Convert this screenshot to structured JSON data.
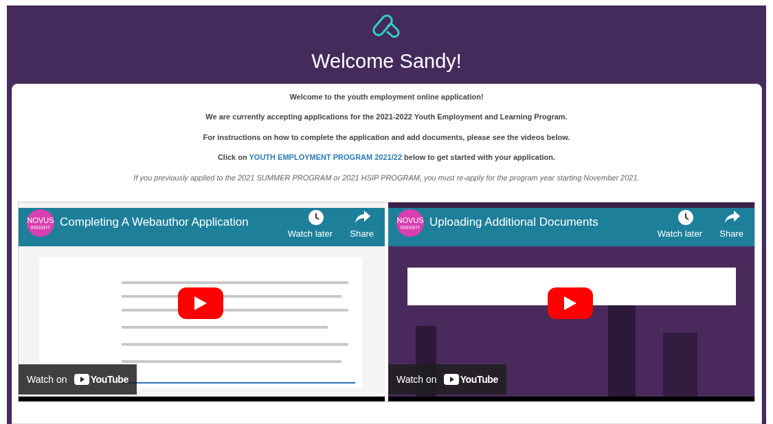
{
  "header": {
    "title": "Welcome Sandy!"
  },
  "intro": {
    "lines": [
      "Welcome to the youth employment online application!",
      "We are currently accepting applications for the 2021-2022 Youth Employment and Learning Program.",
      "For instructions on how to complete the application and add documents, please see the videos below."
    ],
    "cta": {
      "before": "Click on ",
      "link": "YOUTH EMPLOYMENT PROGRAM 2021/22",
      "after": " below to get started with your application."
    },
    "note": "If you previously applied to the 2021 SUMMER PROGRAM or 2021 HSIP PROGRAM, you must re-apply for the program year starting November 2021."
  },
  "videos": [
    {
      "channel": [
        "NOVUS",
        "INSIGHT"
      ],
      "title": "Completing A Webauthor Application",
      "watch_later": "Watch later",
      "share": "Share",
      "watch_on": "Watch on",
      "youtube": "YouTube"
    },
    {
      "channel": [
        "NOVUS",
        "INSIGHT"
      ],
      "title": "Uploading Additional Documents",
      "watch_later": "Watch later",
      "share": "Share",
      "watch_on": "Watch on",
      "youtube": "YouTube"
    }
  ]
}
